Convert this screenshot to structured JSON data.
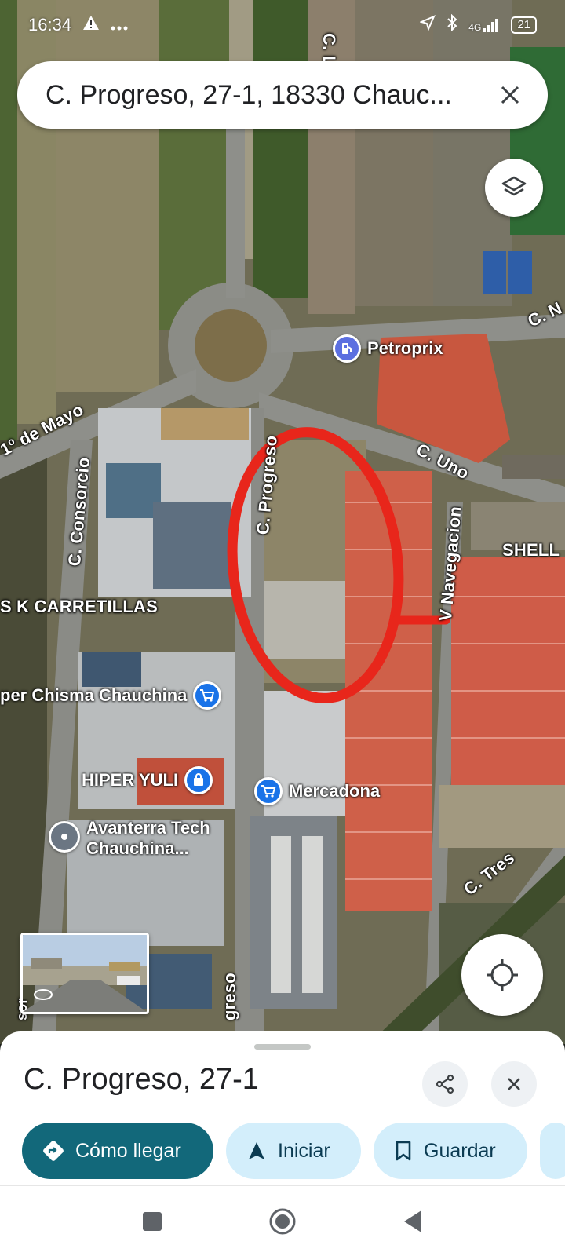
{
  "status_bar": {
    "time": "16:34",
    "network": "4G",
    "battery": "21"
  },
  "search": {
    "query": "C. Progreso, 27-1, 18330 Chauc..."
  },
  "map": {
    "streets": {
      "c_l": "C. L",
      "c_n": "C. N",
      "primero_de_mayo": "1º de Mayo",
      "c_consorcio": "C. Consorcio",
      "c_progreso_upper": "C. Progreso",
      "c_progreso_lower": "greso",
      "c_uno": "C. Uno",
      "navegacion": "V Navegacion",
      "c_tres": "C. Tres",
      "sor": "sor"
    },
    "places": {
      "petroprix": "Petroprix",
      "shell": "SHELL",
      "carretillas": "S K CARRETILLAS",
      "chisma": "per Chisma Chauchina",
      "hiper_yuli": "HIPER YULI",
      "mercadona": "Mercadona",
      "avanterra_line1": "Avanterra Tech",
      "avanterra_line2": "Chauchina..."
    },
    "annotation_color": "#e8261b"
  },
  "place_sheet": {
    "title": "C. Progreso, 27-1",
    "actions": {
      "directions": "Cómo llegar",
      "start": "Iniciar",
      "save": "Guardar"
    }
  },
  "colors": {
    "primary_chip": "#12687a",
    "secondary_chip": "#d3eefb",
    "pin_blue": "#1a73e8"
  },
  "icons": [
    "warning-icon",
    "more-icon",
    "location-arrow-icon",
    "bluetooth-icon",
    "signal-icon",
    "close-icon",
    "layers-icon",
    "fuel-icon",
    "cart-icon",
    "shopping-bag-icon",
    "pin-icon",
    "crosshair-icon",
    "share-icon",
    "directions-icon",
    "navigation-icon",
    "bookmark-icon",
    "square-nav-icon",
    "home-nav-icon",
    "back-nav-icon"
  ]
}
